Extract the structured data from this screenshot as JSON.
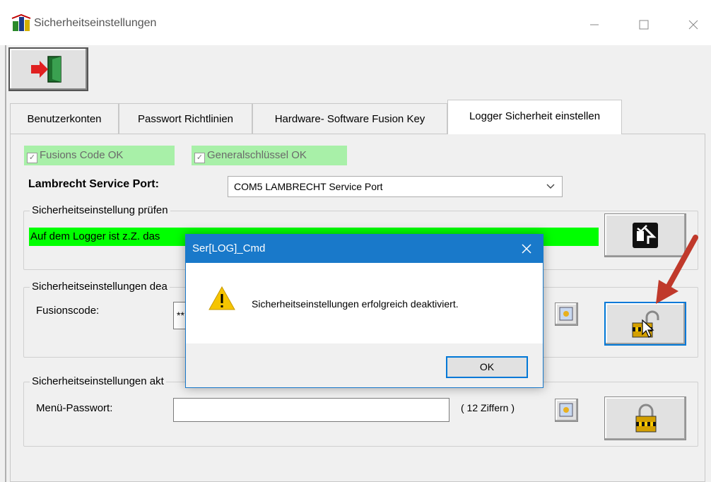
{
  "window": {
    "title": "Sicherheitseinstellungen"
  },
  "tabs": [
    {
      "label": "Benutzerkonten"
    },
    {
      "label": "Passwort Richtlinien"
    },
    {
      "label": "Hardware- Software Fusion Key"
    },
    {
      "label": "Logger Sicherheit einstellen",
      "active": true
    }
  ],
  "status": {
    "fusion_code": "Fusions Code  OK",
    "general_key": "Generalschlüssel OK",
    "chip_color": "#a8f0a8"
  },
  "port": {
    "label": "Lambrecht Service  Port:",
    "selected": "COM5  LAMBRECHT Service Port"
  },
  "check_group": {
    "title": "Sicherheitseinstellung prüfen",
    "status_text": "Auf dem Logger ist z.Z. das",
    "status_color": "#00ff00"
  },
  "deactivate_group": {
    "title": "Sicherheitseinstellungen dea",
    "field_label": "Fusionscode:",
    "field_value": "**"
  },
  "activate_group": {
    "title": "Sicherheitseinstellungen akt",
    "field_label": "Menü-Passwort:",
    "field_value": "",
    "hint": "( 12 Ziffern )"
  },
  "dialog": {
    "title": "Ser[LOG]_Cmd",
    "message": "Sicherheitseinstellungen erfolgreich deaktiviert.",
    "ok_label": "OK",
    "accent": "#1979ca"
  },
  "icons": {
    "window_controls": [
      "minimize-icon",
      "maximize-icon",
      "close-icon"
    ],
    "arrow_color": "#c0392b"
  }
}
